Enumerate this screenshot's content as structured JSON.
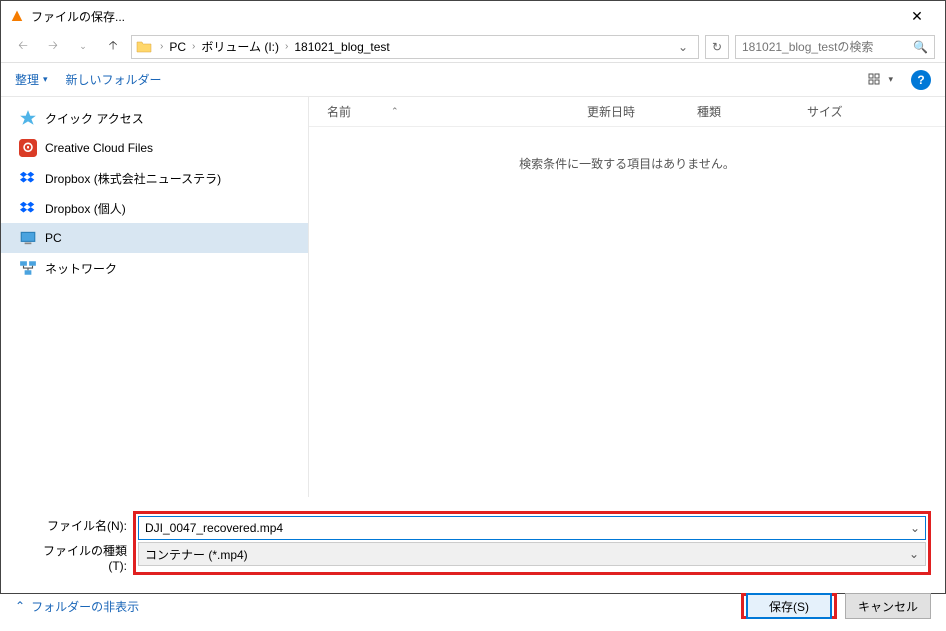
{
  "title": "ファイルの保存...",
  "breadcrumbs": [
    "PC",
    "ボリューム (I:)",
    "181021_blog_test"
  ],
  "search_placeholder": "181021_blog_testの検索",
  "toolbar": {
    "organize": "整理",
    "new_folder": "新しいフォルダー"
  },
  "sidebar": [
    {
      "icon": "star",
      "label": "クイック アクセス"
    },
    {
      "icon": "cc",
      "label": "Creative Cloud Files"
    },
    {
      "icon": "dropbox",
      "label": "Dropbox (株式会社ニューステラ)"
    },
    {
      "icon": "dropbox",
      "label": "Dropbox (個人)"
    },
    {
      "icon": "pc",
      "label": "PC",
      "selected": true
    },
    {
      "icon": "net",
      "label": "ネットワーク"
    }
  ],
  "columns": {
    "name": "名前",
    "date": "更新日時",
    "type": "種類",
    "size": "サイズ"
  },
  "empty_msg": "検索条件に一致する項目はありません。",
  "filename_label": "ファイル名(N):",
  "filetype_label": "ファイルの種類(T):",
  "filename_value": "DJI_0047_recovered.mp4",
  "filetype_value": "コンテナー (*.mp4)",
  "hide_folders": "フォルダーの非表示",
  "save_btn": "保存(S)",
  "cancel_btn": "キャンセル"
}
